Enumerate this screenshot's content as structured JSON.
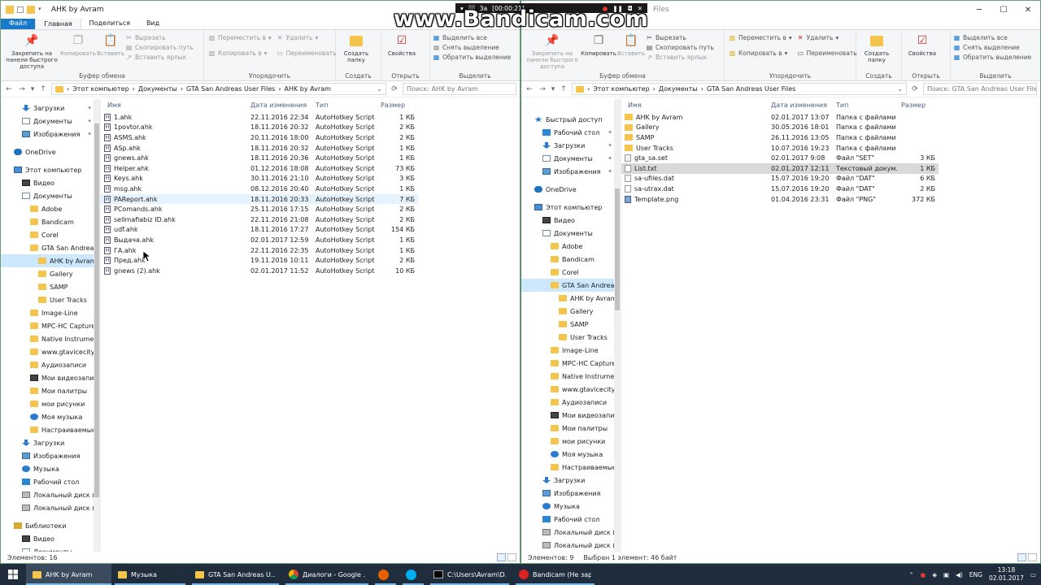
{
  "overlay": {
    "watermark": "www.Bandicam.com",
    "bar_title": "За",
    "bar_timer": "[00:00:21]"
  },
  "left": {
    "title": "AHK by Avram",
    "tabs": [
      "Файл",
      "Главная",
      "Поделиться",
      "Вид"
    ],
    "ribbon": {
      "pin": "Закрепить на панели быстрого доступа",
      "copy": "Копировать",
      "paste": "Вставить",
      "cut": "Вырезать",
      "copy_path": "Скопировать путь",
      "paste_shortcut": "Вставить ярлык",
      "clipboard": "Буфер обмена",
      "move_to": "Переместить в",
      "copy_to": "Копировать в",
      "delete": "Удалить",
      "rename": "Переименовать",
      "organize": "Упорядочить",
      "new_folder": "Создать папку",
      "create": "Создать",
      "properties": "Свойства",
      "open": "Открыть",
      "select_all": "Выделить все",
      "select_none": "Снять выделение",
      "invert": "Обратить выделение",
      "select": "Выделить"
    },
    "path": [
      "Этот компьютер",
      "Документы",
      "GTA San Andreas User Files",
      "AHK by Avram"
    ],
    "search_placeholder": "Поиск: AHK by Avram",
    "nav": [
      {
        "label": "Загрузки",
        "icon": "download-icon",
        "pin": true,
        "indent": 1
      },
      {
        "label": "Документы",
        "icon": "document-icon",
        "pin": true,
        "indent": 1
      },
      {
        "label": "Изображения",
        "icon": "image-icon",
        "pin": true,
        "indent": 1
      },
      {
        "label": "OneDrive",
        "icon": "cloud-icon",
        "indent": 0,
        "gap": true
      },
      {
        "label": "Этот компьютер",
        "icon": "computer-icon",
        "indent": 0,
        "gap": true
      },
      {
        "label": "Видео",
        "icon": "video-icon",
        "indent": 1
      },
      {
        "label": "Документы",
        "icon": "document-icon",
        "indent": 1
      },
      {
        "label": "Adobe",
        "icon": "folder-icon",
        "indent": 2
      },
      {
        "label": "Bandicam",
        "icon": "folder-icon",
        "indent": 2
      },
      {
        "label": "Corel",
        "icon": "folder-icon",
        "indent": 2
      },
      {
        "label": "GTA San Andreas User Files",
        "icon": "folder-icon",
        "indent": 2
      },
      {
        "label": "AHK by Avram",
        "icon": "folder-icon",
        "indent": 3,
        "selected": true
      },
      {
        "label": "Gallery",
        "icon": "folder-icon",
        "indent": 3
      },
      {
        "label": "SAMP",
        "icon": "folder-icon",
        "indent": 3
      },
      {
        "label": "User Tracks",
        "icon": "folder-icon",
        "indent": 3
      },
      {
        "label": "Image-Line",
        "icon": "folder-icon",
        "indent": 2
      },
      {
        "label": "MPC-HC Capture",
        "icon": "folder-icon",
        "indent": 2
      },
      {
        "label": "Native Instruments",
        "icon": "folder-icon",
        "indent": 2
      },
      {
        "label": "www.gtavicecity.ru",
        "icon": "folder-icon",
        "indent": 2
      },
      {
        "label": "Аудиозаписи",
        "icon": "folder-icon",
        "indent": 2
      },
      {
        "label": "Мои видеозаписи",
        "icon": "video-icon",
        "indent": 2
      },
      {
        "label": "Мои палитры",
        "icon": "folder-icon",
        "indent": 2
      },
      {
        "label": "мои рисунки",
        "icon": "folder-icon",
        "indent": 2
      },
      {
        "label": "Моя музыка",
        "icon": "music-icon",
        "indent": 2
      },
      {
        "label": "Настраиваемые шаблоны",
        "icon": "folder-icon",
        "indent": 2
      },
      {
        "label": "Загрузки",
        "icon": "download-icon",
        "indent": 1
      },
      {
        "label": "Изображения",
        "icon": "image-icon",
        "indent": 1
      },
      {
        "label": "Музыка",
        "icon": "music-icon",
        "indent": 1
      },
      {
        "label": "Рабочий стол",
        "icon": "desktop-icon",
        "indent": 1
      },
      {
        "label": "Локальный диск (C:)",
        "icon": "drive-icon",
        "indent": 1
      },
      {
        "label": "Локальный диск (D:)",
        "icon": "drive-icon",
        "indent": 1
      },
      {
        "label": "Библиотеки",
        "icon": "library-icon",
        "indent": 0,
        "gap": true
      },
      {
        "label": "Видео",
        "icon": "video-icon",
        "indent": 1
      },
      {
        "label": "Документы",
        "icon": "document-icon",
        "indent": 1
      }
    ],
    "columns": [
      "Имя",
      "Дата изменения",
      "Тип",
      "Размер"
    ],
    "files": [
      {
        "name": "1.ahk",
        "date": "22.11.2016 22:34",
        "type": "AutoHotkey Script",
        "size": "1 КБ",
        "kind": "ahk"
      },
      {
        "name": "1povtor.ahk",
        "date": "18.11.2016 20:32",
        "type": "AutoHotkey Script",
        "size": "2 КБ",
        "kind": "ahk"
      },
      {
        "name": "ASMS.ahk",
        "date": "20.11.2016 18:00",
        "type": "AutoHotkey Script",
        "size": "2 КБ",
        "kind": "ahk"
      },
      {
        "name": "ASp.ahk",
        "date": "18.11.2016 20:32",
        "type": "AutoHotkey Script",
        "size": "1 КБ",
        "kind": "ahk"
      },
      {
        "name": "gnews.ahk",
        "date": "18.11.2016 20:36",
        "type": "AutoHotkey Script",
        "size": "1 КБ",
        "kind": "ahk"
      },
      {
        "name": "Helper.ahk",
        "date": "01.12.2016 18:08",
        "type": "AutoHotkey Script",
        "size": "73 КБ",
        "kind": "ahk"
      },
      {
        "name": "Keys.ahk",
        "date": "30.11.2016 21:10",
        "type": "AutoHotkey Script",
        "size": "3 КБ",
        "kind": "ahk"
      },
      {
        "name": "msg.ahk",
        "date": "08.12.2016 20:40",
        "type": "AutoHotkey Script",
        "size": "1 КБ",
        "kind": "ahk"
      },
      {
        "name": "PAReport.ahk",
        "date": "18.11.2016 20:33",
        "type": "AutoHotkey Script",
        "size": "7 КБ",
        "kind": "ahk",
        "hover": true
      },
      {
        "name": "PComands.ahk",
        "date": "25.11.2016 17:15",
        "type": "AutoHotkey Script",
        "size": "2 КБ",
        "kind": "ahk"
      },
      {
        "name": "sellmafiabiz ID.ahk",
        "date": "22.11.2016 21:08",
        "type": "AutoHotkey Script",
        "size": "2 КБ",
        "kind": "ahk"
      },
      {
        "name": "udf.ahk",
        "date": "18.11.2016 17:27",
        "type": "AutoHotkey Script",
        "size": "154 КБ",
        "kind": "ahk"
      },
      {
        "name": "Выдача.ahk",
        "date": "02.01.2017 12:59",
        "type": "AutoHotkey Script",
        "size": "1 КБ",
        "kind": "ahk"
      },
      {
        "name": "ГА.ahk",
        "date": "22.11.2016 22:35",
        "type": "AutoHotkey Script",
        "size": "1 КБ",
        "kind": "ahk"
      },
      {
        "name": "Пред.ahk",
        "date": "19.11.2016 10:11",
        "type": "AutoHotkey Script",
        "size": "2 КБ",
        "kind": "ahk"
      },
      {
        "name": "gnews (2).ahk",
        "date": "02.01.2017 11:52",
        "type": "AutoHotkey Script",
        "size": "10 КБ",
        "kind": "ahk"
      }
    ],
    "status": "Элементов: 16"
  },
  "right": {
    "title": "Files",
    "path": [
      "Этот компьютер",
      "Документы",
      "GTA San Andreas User Files"
    ],
    "search_placeholder": "Поиск: GTA San Andreas User Files",
    "nav": [
      {
        "label": "Быстрый доступ",
        "icon": "star-icon",
        "indent": 0,
        "gap": true
      },
      {
        "label": "Рабочий стол",
        "icon": "desktop-icon",
        "pin": true,
        "indent": 1
      },
      {
        "label": "Загрузки",
        "icon": "download-icon",
        "pin": true,
        "indent": 1
      },
      {
        "label": "Документы",
        "icon": "document-icon",
        "pin": true,
        "indent": 1
      },
      {
        "label": "Изображения",
        "icon": "image-icon",
        "pin": true,
        "indent": 1
      },
      {
        "label": "OneDrive",
        "icon": "cloud-icon",
        "indent": 0,
        "gap": true
      },
      {
        "label": "Этот компьютер",
        "icon": "computer-icon",
        "indent": 0,
        "gap": true
      },
      {
        "label": "Видео",
        "icon": "video-icon",
        "indent": 1
      },
      {
        "label": "Документы",
        "icon": "document-icon",
        "indent": 1
      },
      {
        "label": "Adobe",
        "icon": "folder-icon",
        "indent": 2
      },
      {
        "label": "Bandicam",
        "icon": "folder-icon",
        "indent": 2
      },
      {
        "label": "Corel",
        "icon": "folder-icon",
        "indent": 2
      },
      {
        "label": "GTA San Andreas User Files",
        "icon": "folder-icon",
        "indent": 2,
        "selected": true
      },
      {
        "label": "AHK by Avram",
        "icon": "folder-icon",
        "indent": 3
      },
      {
        "label": "Gallery",
        "icon": "folder-icon",
        "indent": 3
      },
      {
        "label": "SAMP",
        "icon": "folder-icon",
        "indent": 3
      },
      {
        "label": "User Tracks",
        "icon": "folder-icon",
        "indent": 3
      },
      {
        "label": "Image-Line",
        "icon": "folder-icon",
        "indent": 2
      },
      {
        "label": "MPC-HC Capture",
        "icon": "folder-icon",
        "indent": 2
      },
      {
        "label": "Native Instruments",
        "icon": "folder-icon",
        "indent": 2
      },
      {
        "label": "www.gtavicecity.ru",
        "icon": "folder-icon",
        "indent": 2
      },
      {
        "label": "Аудиозаписи",
        "icon": "folder-icon",
        "indent": 2
      },
      {
        "label": "Мои видеозаписи",
        "icon": "video-icon",
        "indent": 2
      },
      {
        "label": "Мои палитры",
        "icon": "folder-icon",
        "indent": 2
      },
      {
        "label": "мои рисунки",
        "icon": "folder-icon",
        "indent": 2
      },
      {
        "label": "Моя музыка",
        "icon": "music-icon",
        "indent": 2
      },
      {
        "label": "Настраиваемые шаблоны",
        "icon": "folder-icon",
        "indent": 2
      },
      {
        "label": "Загрузки",
        "icon": "download-icon",
        "indent": 1
      },
      {
        "label": "Изображения",
        "icon": "image-icon",
        "indent": 1
      },
      {
        "label": "Музыка",
        "icon": "music-icon",
        "indent": 1
      },
      {
        "label": "Рабочий стол",
        "icon": "desktop-icon",
        "indent": 1
      },
      {
        "label": "Локальный диск (C:)",
        "icon": "drive-icon",
        "indent": 1
      },
      {
        "label": "Локальный диск (D:)",
        "icon": "drive-icon",
        "indent": 1
      }
    ],
    "files": [
      {
        "name": "AHK by Avram",
        "date": "02.01.2017 13:07",
        "type": "Папка с файлами",
        "size": "",
        "kind": "folder"
      },
      {
        "name": "Gallery",
        "date": "30.05.2016 18:01",
        "type": "Папка с файлами",
        "size": "",
        "kind": "folder"
      },
      {
        "name": "SAMP",
        "date": "26.11.2016 13:05",
        "type": "Папка с файлами",
        "size": "",
        "kind": "folder"
      },
      {
        "name": "User Tracks",
        "date": "10.07.2016 19:23",
        "type": "Папка с файлами",
        "size": "",
        "kind": "folder"
      },
      {
        "name": "gta_sa.set",
        "date": "02.01.2017 9:08",
        "type": "Файл \"SET\"",
        "size": "3 КБ",
        "kind": "set"
      },
      {
        "name": "List.txt",
        "date": "02.01.2017 12:11",
        "type": "Текстовый докум...",
        "size": "1 КБ",
        "kind": "txt",
        "selected": true
      },
      {
        "name": "sa-ufiles.dat",
        "date": "15.07.2016 19:20",
        "type": "Файл \"DAT\"",
        "size": "6 КБ",
        "kind": "txt"
      },
      {
        "name": "sa-utrax.dat",
        "date": "15.07.2016 19:20",
        "type": "Файл \"DAT\"",
        "size": "2 КБ",
        "kind": "txt"
      },
      {
        "name": "Template.png",
        "date": "01.04.2016 23:31",
        "type": "Файл \"PNG\"",
        "size": "372 КБ",
        "kind": "png"
      }
    ],
    "status": "Элементов: 9",
    "status_sel": "Выбран 1 элемент: 46 байт"
  },
  "taskbar": {
    "items": [
      {
        "label": "AHK by Avram",
        "icon": "folder-icon",
        "active": true
      },
      {
        "label": "Музыка",
        "icon": "folder-icon"
      },
      {
        "label": "GTA San Andreas U...",
        "icon": "folder-icon"
      },
      {
        "label": "Диалоги - Google ...",
        "icon": "chrome-icon"
      },
      {
        "label": "",
        "icon": "firefox-icon"
      },
      {
        "label": "",
        "icon": "skype-icon"
      },
      {
        "label": "C:\\Users\\Avram\\D...",
        "icon": "terminal-icon"
      },
      {
        "label": "Bandicam (Не заре...",
        "icon": "record-icon"
      }
    ],
    "lang": "ENG",
    "time": "13:18",
    "date": "02.01.2017"
  }
}
